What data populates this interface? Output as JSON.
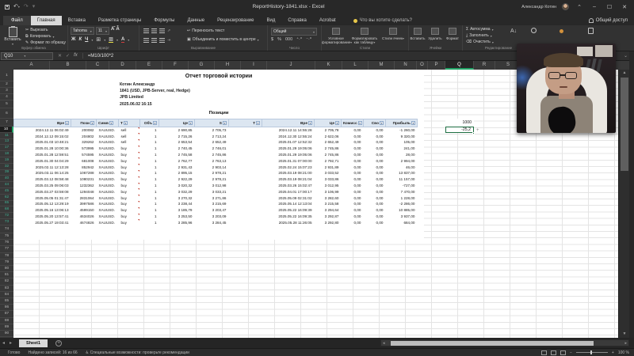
{
  "titlebar": {
    "title": "ReportHistory-1841.xlsx - Excel",
    "user": "Александр Котин",
    "minimize": "–",
    "maximize": "☐",
    "close": "✕"
  },
  "tabs": {
    "file": "Файл",
    "items": [
      "Главная",
      "Вставка",
      "Разметка страницы",
      "Формулы",
      "Данные",
      "Рецензирование",
      "Вид",
      "Справка",
      "Acrobat"
    ],
    "active": "Главная",
    "tellme": "Что вы хотите сделать?",
    "share": "Общий доступ"
  },
  "ribbon": {
    "clipboard": {
      "label": "Буфер обмена",
      "paste": "Вставить",
      "cut": "Вырезать",
      "copy": "Копировать",
      "format_painter": "Формат по образцу"
    },
    "font": {
      "label": "Шрифт",
      "family": "Tahoma",
      "size": "11",
      "bold": "Ж",
      "italic": "К",
      "underline": "Ч"
    },
    "alignment": {
      "label": "Выравнивание",
      "wrap": "Переносить текст",
      "merge": "Объединить и поместить в центре"
    },
    "number": {
      "label": "Число",
      "format": "Общий"
    },
    "styles": {
      "label": "Стили",
      "conditional": "Условное форматирование",
      "format_table": "Форматировать как таблицу",
      "cell_styles": "Стили ячеек"
    },
    "cells": {
      "label": "Ячейки",
      "insert": "Вставить",
      "delete": "Удалить",
      "format": "Формат"
    },
    "editing": {
      "label": "Редактирование",
      "autosum": "Автосумма",
      "fill": "Заполнить",
      "clear": "Очистить"
    }
  },
  "formula_bar": {
    "name_box": "Q10",
    "formula": "=M10/100*2"
  },
  "sheet": {
    "col_letters": [
      "A",
      "B",
      "C",
      "D",
      "E",
      "F",
      "G",
      "H",
      "I",
      "J",
      "K",
      "L",
      "M",
      "N",
      "O",
      "P",
      "Q",
      "R",
      "S"
    ],
    "selected_col": "Q",
    "row_numbers": [
      "1",
      "2",
      "3",
      "4",
      "5",
      "6",
      "7",
      "10",
      "11",
      "13",
      "17",
      "18",
      "19",
      "32",
      "39",
      "40",
      "44",
      "45",
      "62",
      "65",
      "68",
      "72",
      "73",
      "74",
      "75",
      "76",
      "77",
      "78",
      "79",
      "80",
      "81",
      "82",
      "83",
      "84",
      "85",
      "86",
      "87",
      "88",
      "89",
      "90"
    ],
    "filtered_rows": [
      "10",
      "11",
      "13",
      "17",
      "18",
      "19",
      "32",
      "39",
      "40",
      "44",
      "45",
      "62",
      "65",
      "68",
      "72",
      "73"
    ],
    "selected_row": "10",
    "report": {
      "title": "Отчет торговой истории",
      "fields": [
        {
          "label": "Имя:",
          "value": "Котин Александр"
        },
        {
          "label": "Торговый счет:",
          "value": "1841 (USD, JPB-Server, real, Hedge)"
        },
        {
          "label": "Компания:",
          "value": "JPB Limited"
        },
        {
          "label": "Дата:",
          "value": "2025.06.02 16:15"
        }
      ],
      "section": "Позиции"
    },
    "table": {
      "headers": [
        "Вре",
        "Пози",
        "Симв",
        "Т",
        "Объ",
        "Це",
        "S",
        "Т",
        "Вре",
        "Це",
        "Комисс",
        "Сво",
        "Прибыль"
      ],
      "filtered_header_index": 2,
      "rows": [
        [
          "2024.12.11 06:02:49",
          "200082",
          "XAUUSD.",
          "sell",
          "1",
          "2 690,85",
          "2 705,73",
          "",
          "2024.12.11 14:55:28",
          "2 705,78",
          "0,00",
          "0,00",
          "-1 260,00"
        ],
        [
          "2024.12.12 09:15:02",
          "204802",
          "XAUUSD.",
          "sell",
          "1",
          "2 715,26",
          "2 713,24",
          "",
          "2024.12.30 12:55:24",
          "2 622,06",
          "0,00",
          "0,00",
          "9 320,00"
        ],
        [
          "2025.01.03 10:48:21",
          "329262",
          "XAUUSD.",
          "sell",
          "1",
          "2 653,54",
          "2 652,49",
          "",
          "2025.01.07 12:52:32",
          "2 652,49",
          "0,00",
          "0,00",
          "105,00"
        ],
        [
          "2025.01.28 10:00:36",
          "573995",
          "XAUUSD.",
          "buy",
          "1",
          "2 740,45",
          "2 746,01",
          "",
          "2025.01.29 19:05:06",
          "2 745,86",
          "0,00",
          "0,00",
          "241,00"
        ],
        [
          "2025.01.28 12:59:51",
          "574595",
          "XAUUSD.",
          "buy",
          "1",
          "2 745,58",
          "2 745,86",
          "",
          "2025.01.29 19:05:06",
          "2 745,86",
          "0,00",
          "0,00",
          "28,00"
        ],
        [
          "2025.01.30 04:04:29",
          "681008",
          "XAUUSD.",
          "buy",
          "1",
          "2 762,77",
          "2 763,13",
          "",
          "2025.01.31 07:00:00",
          "2 792,71",
          "0,00",
          "0,00",
          "2 994,00"
        ],
        [
          "2025.02.11 12:13:28",
          "852942",
          "XAUUSD.",
          "buy",
          "1",
          "2 931,43",
          "2 903,14",
          "",
          "2025.02.24 15:07:23",
          "2 931,89",
          "0,00",
          "0,00",
          "46,00"
        ],
        [
          "2025.03.11 06:14:25",
          "1067288",
          "XAUUSD.",
          "buy",
          "1",
          "2 895,15",
          "2 978,21",
          "",
          "2025.03.19 08:21:00",
          "3 033,52",
          "0,00",
          "0,00",
          "13 837,00"
        ],
        [
          "2025.03.12 08:58:48",
          "1080231",
          "XAUUSD.",
          "buy",
          "1",
          "2 922,29",
          "2 978,21",
          "",
          "2025.03.19 08:21:04",
          "3 033,86",
          "0,00",
          "0,00",
          "11 157,00"
        ],
        [
          "2025.03.25 09:06:03",
          "1232362",
          "XAUUSD.",
          "buy",
          "1",
          "3 020,32",
          "3 012,98",
          "",
          "2025.03.26 15:02:47",
          "3 012,95",
          "0,00",
          "0,00",
          "-727,00"
        ],
        [
          "2025.03.27 03:59:08",
          "1294048",
          "XAUUSD.",
          "buy",
          "1",
          "3 032,29",
          "3 033,21",
          "",
          "2025.04.01 17:00:17",
          "3 106,99",
          "0,00",
          "0,00",
          "7 470,00"
        ],
        [
          "2025.05.05 01:31:47",
          "2831064",
          "XAUUSD.",
          "buy",
          "1",
          "3 270,32",
          "3 271,86",
          "",
          "2025.05.09 02:31:02",
          "3 282,60",
          "0,00",
          "0,00",
          "1 228,00"
        ],
        [
          "2025.05.12 13:29:19",
          "3997586",
          "XAUUSD.",
          "buy",
          "1",
          "3 238,44",
          "3 215,69",
          "",
          "2025.05.14 12:13:04",
          "3 215,58",
          "0,00",
          "0,00",
          "-2 286,00"
        ],
        [
          "2025.05.16 13:06:13",
          "4599150",
          "XAUUSD.",
          "buy",
          "1",
          "3 185,79",
          "3 203,47",
          "",
          "2025.05.22 16:09:39",
          "3 294,64",
          "0,00",
          "0,00",
          "10 885,00"
        ],
        [
          "2025.05.20 13:57:41",
          "4634026",
          "XAUUSD.",
          "buy",
          "1",
          "3 253,50",
          "3 203,09",
          "",
          "2025.05.22 16:09:35",
          "3 292,87",
          "0,00",
          "0,00",
          "3 937,00"
        ],
        [
          "2025.05.27 19:03:41",
          "4674826",
          "XAUUSD.",
          "buy",
          "1",
          "3 285,96",
          "3 284,45",
          "",
          "2025.05.28 11:26:05",
          "3 292,80",
          "0,00",
          "0,00",
          "684,00"
        ]
      ]
    },
    "cells": {
      "q7": "1000",
      "q10": "-25,2"
    }
  },
  "sheet_tabs": {
    "active": "Sheet1"
  },
  "status_bar": {
    "ready": "Готово",
    "records": "Найдено записей: 16 из 66",
    "accessibility": "Специальные возможности: проверьте рекомендации",
    "zoom": "100 %"
  }
}
